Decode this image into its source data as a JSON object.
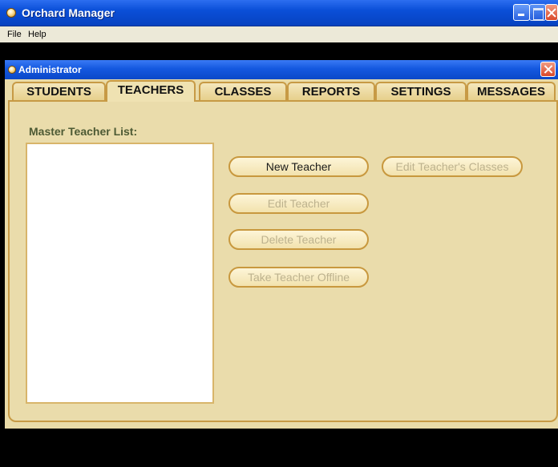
{
  "window": {
    "title": "Orchard Manager",
    "controls": {
      "minimize": "minimize-icon",
      "maximize": "maximize-icon",
      "close": "close-icon"
    }
  },
  "menubar": {
    "items": [
      {
        "label": "File"
      },
      {
        "label": "Help"
      }
    ]
  },
  "admin_window": {
    "title": "Administrator"
  },
  "tabs": [
    {
      "label": "STUDENTS",
      "active": false
    },
    {
      "label": "TEACHERS",
      "active": true
    },
    {
      "label": "CLASSES",
      "active": false
    },
    {
      "label": "REPORTS",
      "active": false
    },
    {
      "label": "SETTINGS",
      "active": false
    },
    {
      "label": "MESSAGES",
      "active": false
    }
  ],
  "teachers_panel": {
    "list_label": "Master Teacher List:",
    "teachers": [],
    "buttons": {
      "new_teacher": {
        "label": "New Teacher",
        "enabled": true
      },
      "edit_teacher_classes": {
        "label": "Edit Teacher's Classes",
        "enabled": false
      },
      "edit_teacher": {
        "label": "Edit Teacher",
        "enabled": false
      },
      "delete_teacher": {
        "label": "Delete Teacher",
        "enabled": false
      },
      "take_teacher_offline": {
        "label": "Take Teacher Offline",
        "enabled": false
      }
    }
  },
  "colors": {
    "titlebar_blue": "#0a4fd8",
    "panel_background": "#eadcab",
    "tab_border": "#c79a45",
    "disabled_text": "#bdb28e"
  }
}
